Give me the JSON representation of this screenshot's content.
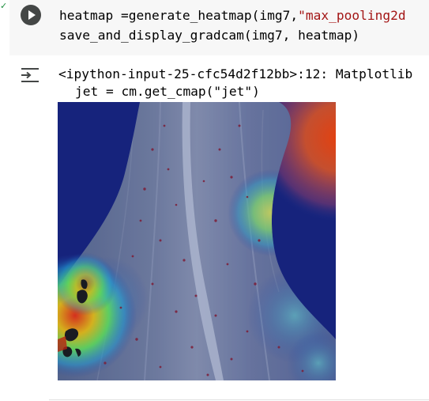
{
  "cell": {
    "run_button_icon": "play-circle-icon",
    "status_icon": "checkmark-icon",
    "code": {
      "line1_prefix": "heatmap =generate_heatmap(img7,",
      "line1_string": "\"max_pooling2d",
      "line2": "save_and_display_gradcam(img7, heatmap)"
    }
  },
  "output": {
    "toggle_icon": "output-collapse-icon",
    "warning_line1": "<ipython-input-25-cfc54d2f12bb>:12: Matplotlib",
    "warning_line2": "jet = cm.get_cmap(\"jet\")",
    "image_description_icon": "gradcam-heatmap-image"
  },
  "colors": {
    "cell_background": "#f7f7f7",
    "run_button": "#444746",
    "string_literal": "#a31515",
    "status_check": "#1e8e3e"
  }
}
